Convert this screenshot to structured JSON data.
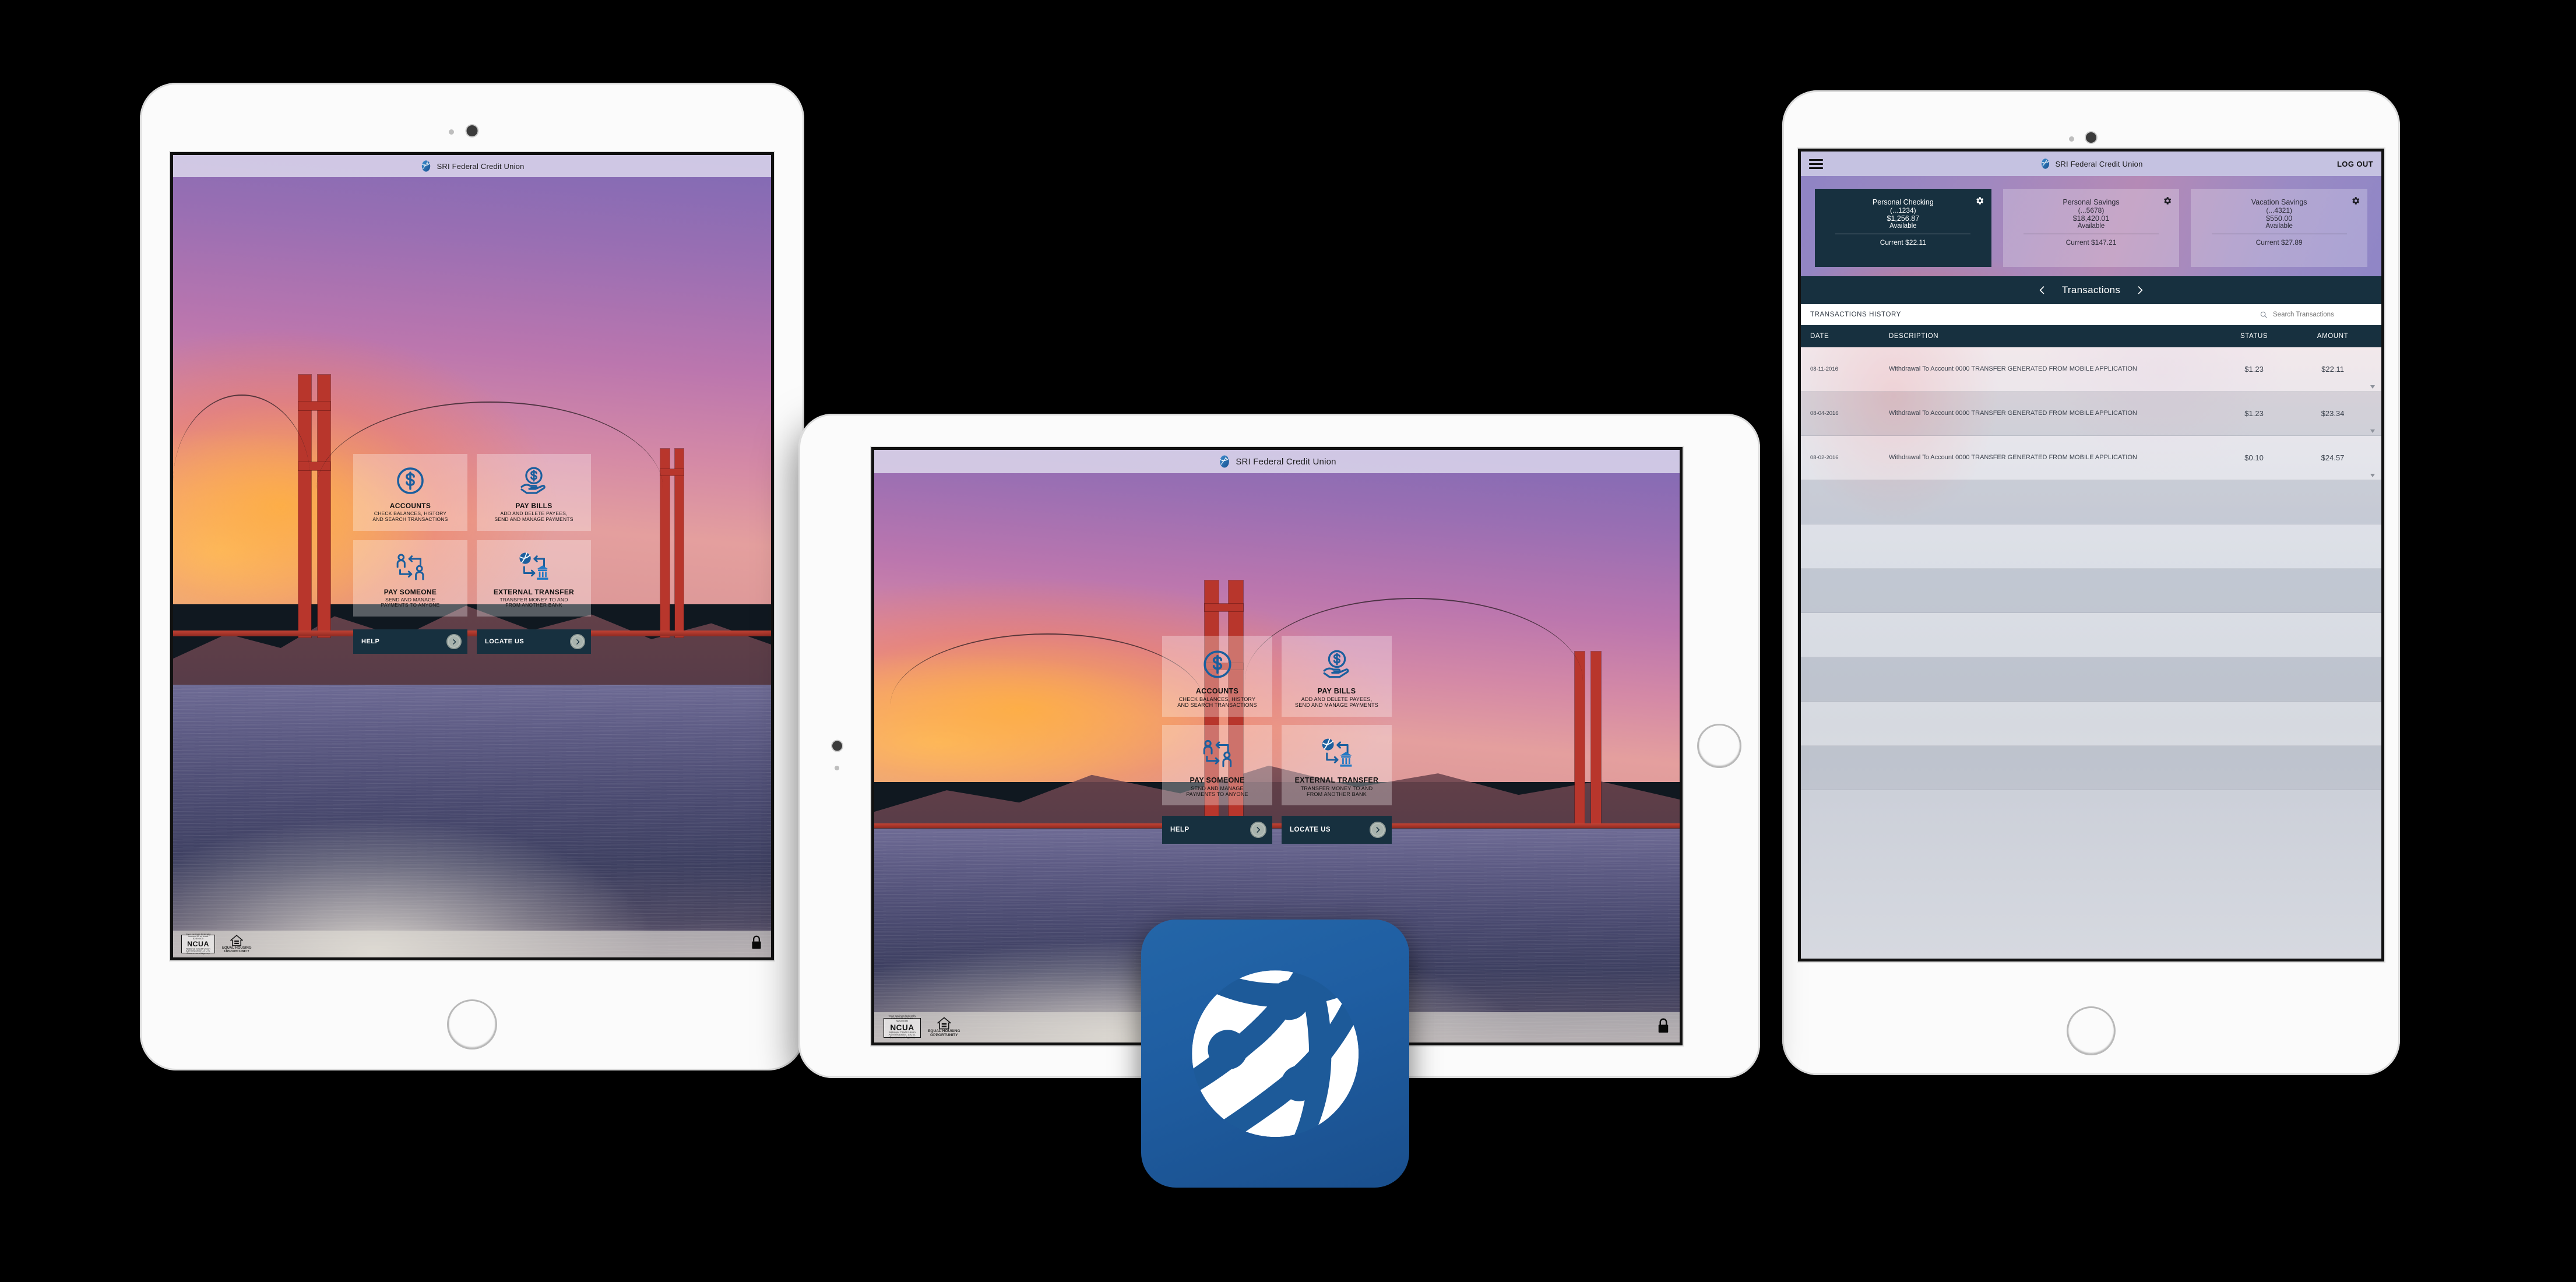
{
  "brand": {
    "name": "SRI Federal Credit Union",
    "logo_icon": "globe-network-logo",
    "app_icon": "globe-network-app-icon",
    "accent": "#1f5ea2",
    "dark": "#17303f"
  },
  "home_screen": {
    "header": {
      "brand_name": "SRI Federal Credit Union"
    },
    "tiles": [
      {
        "icon": "dollar-coin-icon",
        "title": "ACCOUNTS",
        "sub_line1": "CHECK BALANCES, HISTORY",
        "sub_line2": "AND SEARCH TRANSACTIONS"
      },
      {
        "icon": "coin-in-hand-icon",
        "title": "PAY BILLS",
        "sub_line1": "ADD AND DELETE PAYEES,",
        "sub_line2": "SEND AND MANAGE PAYMENTS"
      },
      {
        "icon": "person-to-person-icon",
        "title": "PAY SOMEONE",
        "sub_line1": "SEND AND MANAGE",
        "sub_line2": "PAYMENTS TO ANYONE"
      },
      {
        "icon": "globe-to-bank-icon",
        "title": "EXTERNAL TRANSFER",
        "sub_line1": "TRANSFER MONEY TO AND",
        "sub_line2": "FROM ANOTHER BANK"
      }
    ],
    "buttons": [
      {
        "label": "HELP",
        "icon": "chevron-right-icon"
      },
      {
        "label": "LOCATE US",
        "icon": "chevron-right-icon"
      }
    ],
    "footer": {
      "ncua_top": "Your savings federally insured to at least $250,000",
      "ncua_name": "NCUA",
      "ncua_bottom": "National Credit Union Administration, a U.S. Government Agency",
      "eho_line1": "EQUAL HOUSING",
      "eho_line2": "OPPORTUNITY",
      "lock_icon": "padlock-icon"
    }
  },
  "accounts_screen": {
    "header": {
      "menu_icon": "hamburger-menu-icon",
      "brand_name": "SRI Federal Credit Union",
      "logout_label": "LOG OUT"
    },
    "accounts": [
      {
        "name": "Personal Checking",
        "number": "(...1234)",
        "balance": "$1,256.87",
        "balance_label": "Available",
        "current": "Current $22.11",
        "gear_icon": "gear-icon",
        "selected": true
      },
      {
        "name": "Personal Savings",
        "number": "(...5678)",
        "balance": "$18,420.01",
        "balance_label": "Available",
        "current": "Current $147.21",
        "gear_icon": "gear-icon",
        "selected": false
      },
      {
        "name": "Vacation Savings",
        "number": "(...4321)",
        "balance": "$550.00",
        "balance_label": "Available",
        "current": "Current $27.89",
        "gear_icon": "gear-icon",
        "selected": false
      }
    ],
    "section_nav": {
      "prev_icon": "chevron-left-icon",
      "title": "Transactions",
      "next_icon": "chevron-right-icon"
    },
    "toolbar": {
      "history_label": "TRANSACTIONS HISTORY",
      "search_icon": "search-icon",
      "search_placeholder": "Search Transactions",
      "search_value": ""
    },
    "table": {
      "columns": [
        "DATE",
        "DESCRIPTION",
        "STATUS",
        "AMOUNT"
      ],
      "rows": [
        {
          "date": "08-11-2016",
          "description": "Withdrawal To Account 0000 TRANSFER GENERATED FROM MOBILE APPLICATION",
          "status": "$1.23",
          "amount": "$22.11",
          "expand_icon": "caret-down-icon"
        },
        {
          "date": "08-04-2016",
          "description": "Withdrawal To Account 0000 TRANSFER GENERATED FROM MOBILE APPLICATION",
          "status": "$1.23",
          "amount": "$23.34",
          "expand_icon": "caret-down-icon"
        },
        {
          "date": "08-02-2016",
          "description": "Withdrawal To Account 0000 TRANSFER GENERATED FROM MOBILE APPLICATION",
          "status": "$0.10",
          "amount": "$24.57",
          "expand_icon": "caret-down-icon"
        }
      ],
      "empty_row_count": 7
    }
  }
}
